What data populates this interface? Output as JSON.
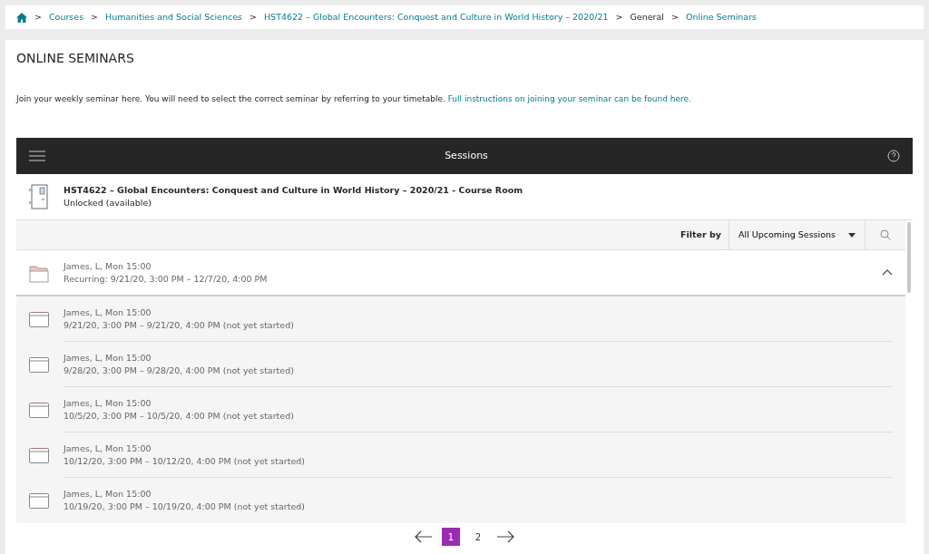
{
  "breadcrumb": [
    {
      "label": "Courses",
      "link": true
    },
    {
      "label": "Humanities and Social Sciences",
      "link": true
    },
    {
      "label": "HST4622 – Global Encounters: Conquest and Culture in World History – 2020/21",
      "link": true
    },
    {
      "label": "General",
      "link": false
    },
    {
      "label": "Online Seminars",
      "link": true
    }
  ],
  "separator": ">",
  "page_title": "ONLINE SEMINARS",
  "intro": {
    "text": "Join your weekly seminar here. You will need to select the correct seminar by referring to your timetable.",
    "link": "Full instructions on joining your seminar can be found here."
  },
  "panel": {
    "title": "Sessions",
    "course_room": {
      "title": "HST4622 – Global Encounters: Conquest and Culture in World History – 2020/21 - Course Room",
      "status": "Unlocked (available)"
    },
    "filter": {
      "label": "Filter by",
      "value": "All Upcoming Sessions"
    },
    "group": {
      "title": "James, L, Mon 15:00",
      "detail": "Recurring: 9/21/20, 3:00 PM – 12/7/20, 4:00 PM",
      "expanded": true
    },
    "sessions": [
      {
        "title": "James, L, Mon 15:00",
        "detail": "9/21/20, 3:00 PM – 9/21/20, 4:00 PM (not yet started)"
      },
      {
        "title": "James, L, Mon 15:00",
        "detail": "9/28/20, 3:00 PM – 9/28/20, 4:00 PM (not yet started)"
      },
      {
        "title": "James, L, Mon 15:00",
        "detail": "10/5/20, 3:00 PM – 10/5/20, 4:00 PM (not yet started)"
      },
      {
        "title": "James, L, Mon 15:00",
        "detail": "10/12/20, 3:00 PM – 10/12/20, 4:00 PM (not yet started)"
      },
      {
        "title": "James, L, Mon 15:00",
        "detail": "10/19/20, 3:00 PM – 10/19/20, 4:00 PM (not yet started)"
      }
    ]
  },
  "pagination": [
    {
      "label": "1",
      "selected": true
    },
    {
      "label": "2",
      "selected": false
    }
  ]
}
